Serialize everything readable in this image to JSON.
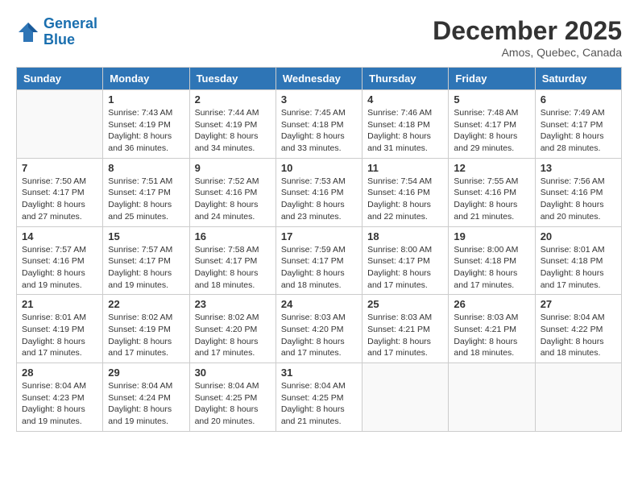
{
  "header": {
    "logo_line1": "General",
    "logo_line2": "Blue",
    "month_year": "December 2025",
    "location": "Amos, Quebec, Canada"
  },
  "weekdays": [
    "Sunday",
    "Monday",
    "Tuesday",
    "Wednesday",
    "Thursday",
    "Friday",
    "Saturday"
  ],
  "weeks": [
    [
      {
        "day": "",
        "info": ""
      },
      {
        "day": "1",
        "info": "Sunrise: 7:43 AM\nSunset: 4:19 PM\nDaylight: 8 hours\nand 36 minutes."
      },
      {
        "day": "2",
        "info": "Sunrise: 7:44 AM\nSunset: 4:19 PM\nDaylight: 8 hours\nand 34 minutes."
      },
      {
        "day": "3",
        "info": "Sunrise: 7:45 AM\nSunset: 4:18 PM\nDaylight: 8 hours\nand 33 minutes."
      },
      {
        "day": "4",
        "info": "Sunrise: 7:46 AM\nSunset: 4:18 PM\nDaylight: 8 hours\nand 31 minutes."
      },
      {
        "day": "5",
        "info": "Sunrise: 7:48 AM\nSunset: 4:17 PM\nDaylight: 8 hours\nand 29 minutes."
      },
      {
        "day": "6",
        "info": "Sunrise: 7:49 AM\nSunset: 4:17 PM\nDaylight: 8 hours\nand 28 minutes."
      }
    ],
    [
      {
        "day": "7",
        "info": "Sunrise: 7:50 AM\nSunset: 4:17 PM\nDaylight: 8 hours\nand 27 minutes."
      },
      {
        "day": "8",
        "info": "Sunrise: 7:51 AM\nSunset: 4:17 PM\nDaylight: 8 hours\nand 25 minutes."
      },
      {
        "day": "9",
        "info": "Sunrise: 7:52 AM\nSunset: 4:16 PM\nDaylight: 8 hours\nand 24 minutes."
      },
      {
        "day": "10",
        "info": "Sunrise: 7:53 AM\nSunset: 4:16 PM\nDaylight: 8 hours\nand 23 minutes."
      },
      {
        "day": "11",
        "info": "Sunrise: 7:54 AM\nSunset: 4:16 PM\nDaylight: 8 hours\nand 22 minutes."
      },
      {
        "day": "12",
        "info": "Sunrise: 7:55 AM\nSunset: 4:16 PM\nDaylight: 8 hours\nand 21 minutes."
      },
      {
        "day": "13",
        "info": "Sunrise: 7:56 AM\nSunset: 4:16 PM\nDaylight: 8 hours\nand 20 minutes."
      }
    ],
    [
      {
        "day": "14",
        "info": "Sunrise: 7:57 AM\nSunset: 4:16 PM\nDaylight: 8 hours\nand 19 minutes."
      },
      {
        "day": "15",
        "info": "Sunrise: 7:57 AM\nSunset: 4:17 PM\nDaylight: 8 hours\nand 19 minutes."
      },
      {
        "day": "16",
        "info": "Sunrise: 7:58 AM\nSunset: 4:17 PM\nDaylight: 8 hours\nand 18 minutes."
      },
      {
        "day": "17",
        "info": "Sunrise: 7:59 AM\nSunset: 4:17 PM\nDaylight: 8 hours\nand 18 minutes."
      },
      {
        "day": "18",
        "info": "Sunrise: 8:00 AM\nSunset: 4:17 PM\nDaylight: 8 hours\nand 17 minutes."
      },
      {
        "day": "19",
        "info": "Sunrise: 8:00 AM\nSunset: 4:18 PM\nDaylight: 8 hours\nand 17 minutes."
      },
      {
        "day": "20",
        "info": "Sunrise: 8:01 AM\nSunset: 4:18 PM\nDaylight: 8 hours\nand 17 minutes."
      }
    ],
    [
      {
        "day": "21",
        "info": "Sunrise: 8:01 AM\nSunset: 4:19 PM\nDaylight: 8 hours\nand 17 minutes."
      },
      {
        "day": "22",
        "info": "Sunrise: 8:02 AM\nSunset: 4:19 PM\nDaylight: 8 hours\nand 17 minutes."
      },
      {
        "day": "23",
        "info": "Sunrise: 8:02 AM\nSunset: 4:20 PM\nDaylight: 8 hours\nand 17 minutes."
      },
      {
        "day": "24",
        "info": "Sunrise: 8:03 AM\nSunset: 4:20 PM\nDaylight: 8 hours\nand 17 minutes."
      },
      {
        "day": "25",
        "info": "Sunrise: 8:03 AM\nSunset: 4:21 PM\nDaylight: 8 hours\nand 17 minutes."
      },
      {
        "day": "26",
        "info": "Sunrise: 8:03 AM\nSunset: 4:21 PM\nDaylight: 8 hours\nand 18 minutes."
      },
      {
        "day": "27",
        "info": "Sunrise: 8:04 AM\nSunset: 4:22 PM\nDaylight: 8 hours\nand 18 minutes."
      }
    ],
    [
      {
        "day": "28",
        "info": "Sunrise: 8:04 AM\nSunset: 4:23 PM\nDaylight: 8 hours\nand 19 minutes."
      },
      {
        "day": "29",
        "info": "Sunrise: 8:04 AM\nSunset: 4:24 PM\nDaylight: 8 hours\nand 19 minutes."
      },
      {
        "day": "30",
        "info": "Sunrise: 8:04 AM\nSunset: 4:25 PM\nDaylight: 8 hours\nand 20 minutes."
      },
      {
        "day": "31",
        "info": "Sunrise: 8:04 AM\nSunset: 4:25 PM\nDaylight: 8 hours\nand 21 minutes."
      },
      {
        "day": "",
        "info": ""
      },
      {
        "day": "",
        "info": ""
      },
      {
        "day": "",
        "info": ""
      }
    ]
  ]
}
